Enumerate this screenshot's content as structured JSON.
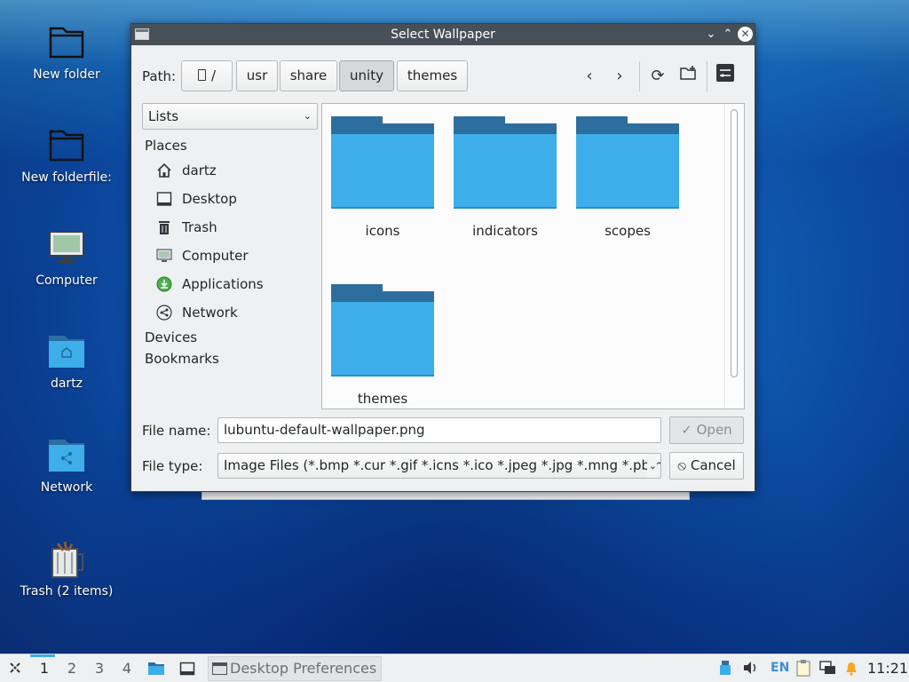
{
  "desktop": {
    "icons": [
      {
        "label": "New folder"
      },
      {
        "label": "New folderfile:"
      },
      {
        "label": "Computer"
      },
      {
        "label": "dartz"
      },
      {
        "label": "Network"
      },
      {
        "label": "Trash (2 items)"
      }
    ]
  },
  "dialog": {
    "title": "Select Wallpaper",
    "path_label": "Path:",
    "breadcrumbs": [
      "/",
      "usr",
      "share",
      "unity",
      "themes"
    ],
    "active_crumb": "unity",
    "view_mode": "Lists",
    "places_header": "Places",
    "places": [
      "dartz",
      "Desktop",
      "Trash",
      "Computer",
      "Applications",
      "Network"
    ],
    "devices_header": "Devices",
    "bookmarks_header": "Bookmarks",
    "folders": [
      "icons",
      "indicators",
      "scopes",
      "themes"
    ],
    "file_name_label": "File name:",
    "file_name_value": "lubuntu-default-wallpaper.png",
    "file_type_label": "File type:",
    "file_type_value": "Image Files (*.bmp *.cur *.gif *.icns *.ico *.jpeg *.jpg *.mng *.pbm",
    "open_label": "Open",
    "cancel_label": "Cancel",
    "colors": {
      "titlebar": "#475057",
      "folder_front": "#3daee9",
      "folder_back": "#2d6e9e",
      "accent": "#3daee9"
    }
  },
  "taskbar": {
    "workspaces": [
      "1",
      "2",
      "3",
      "4"
    ],
    "active_workspace": "1",
    "task_title": "Desktop Preferences",
    "keyboard_layout": "EN",
    "clock": "11:21"
  }
}
